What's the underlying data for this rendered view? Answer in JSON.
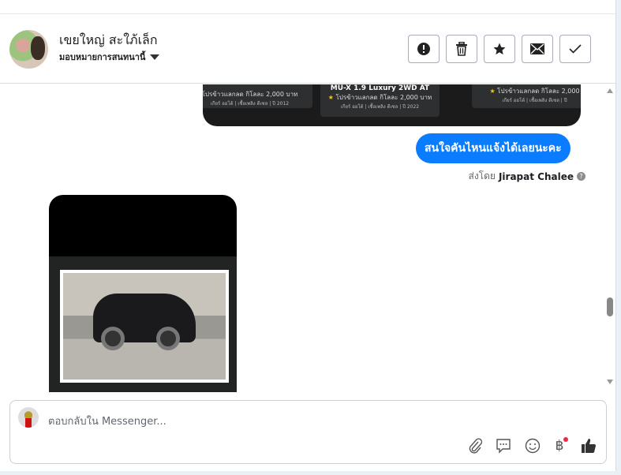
{
  "header": {
    "contact_name": "เขยใหญ่ สะใภ้เล็ก",
    "assign_label": "มอบหมายการสนทนานี้",
    "actions": [
      {
        "name": "mark-spam",
        "icon": "exclamation-circle-icon"
      },
      {
        "name": "delete",
        "icon": "trash-icon"
      },
      {
        "name": "star",
        "icon": "star-icon"
      },
      {
        "name": "mark-unread",
        "icon": "envelope-icon"
      },
      {
        "name": "mark-done",
        "icon": "check-icon"
      }
    ]
  },
  "carousel": {
    "cards": [
      {
        "title": "",
        "promo": "โปรข้าวแลกลด กิโลละ 2,000 บาท",
        "meta": "เกียร์ ออโต้ | เชื้อเพลิง ดีเซล | ปี 2012"
      },
      {
        "title": "MU-X 1.9 Luxury 2WD AT",
        "promo": "โปรข้าวแลกลด กิโลละ 2,000 บาท",
        "meta": "เกียร์ ออโต้ | เชื้อเพลิง ดีเซล | ปี 2022"
      },
      {
        "title": "",
        "promo": "โปรข้าวแลกลด กิโลละ 2,000",
        "meta": "เกียร์ ออโต้ | เชื้อเพลิง ดีเซล | ปี"
      }
    ]
  },
  "messages": {
    "outgoing_text": "สนใจคันไหนแจ้งได้เลยนะคะ",
    "sent_by_prefix": "ส่งโดย",
    "sent_by_name": "Jirapat Chalee",
    "help_glyph": "?"
  },
  "composer": {
    "placeholder": "ตอบกลับใน Messenger...",
    "icons": [
      "paperclip-icon",
      "chat-bubble-icon",
      "smiley-icon",
      "baht-icon",
      "thumbs-up-icon"
    ],
    "baht_glyph": "฿"
  },
  "colors": {
    "accent": "#0a7cff",
    "notification_dot": "#f02849"
  }
}
